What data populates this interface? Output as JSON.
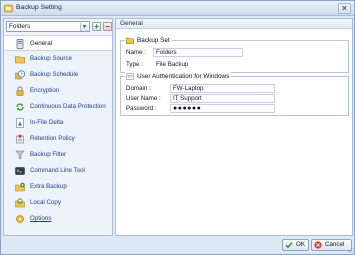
{
  "window": {
    "title": "Backup Setting",
    "close_glyph": "✕"
  },
  "sidebar": {
    "folder_select": {
      "value": "Folders",
      "arrow": "▼"
    },
    "add_glyph": "+",
    "remove_glyph": "−",
    "items": [
      {
        "label": "General",
        "icon": "general-settings-icon",
        "active": true
      },
      {
        "label": "Backup Source",
        "icon": "backup-source-icon"
      },
      {
        "label": "Backup Schedule",
        "icon": "schedule-clock-icon"
      },
      {
        "label": "Encryption",
        "icon": "encryption-lock-icon"
      },
      {
        "label": "Continuous Data Protection",
        "icon": "continuous-data-protection-icon"
      },
      {
        "label": "In-File Delta",
        "icon": "in-file-delta-icon"
      },
      {
        "label": "Retention Policy",
        "icon": "retention-policy-icon"
      },
      {
        "label": "Backup Filter",
        "icon": "filter-funnel-icon"
      },
      {
        "label": "Command Line Tool",
        "icon": "command-line-icon"
      },
      {
        "label": "Extra Backup",
        "icon": "extra-backup-icon"
      },
      {
        "label": "Local Copy",
        "icon": "local-copy-icon"
      },
      {
        "label": "Options",
        "icon": "options-icon"
      }
    ]
  },
  "main": {
    "header": "General",
    "backup_set": {
      "title": "Backup Set",
      "name_label": "Name :",
      "name_value": "Folders",
      "type_label": "Type :",
      "type_value": "File Backup"
    },
    "auth": {
      "title": "User Authentication for Windows",
      "domain_label": "Domain :",
      "domain_value": "FW-Laptop",
      "username_label": "User Name :",
      "username_value": "IT Support",
      "password_label": "Password :",
      "password_value": "●●●●●●"
    }
  },
  "footer": {
    "ok_label": "OK",
    "cancel_label": "Cancel"
  },
  "colors": {
    "accent": "#1d3f8a",
    "border": "#a9bcd6",
    "ok_green": "#2f8a22",
    "cancel_red": "#c0392b"
  }
}
